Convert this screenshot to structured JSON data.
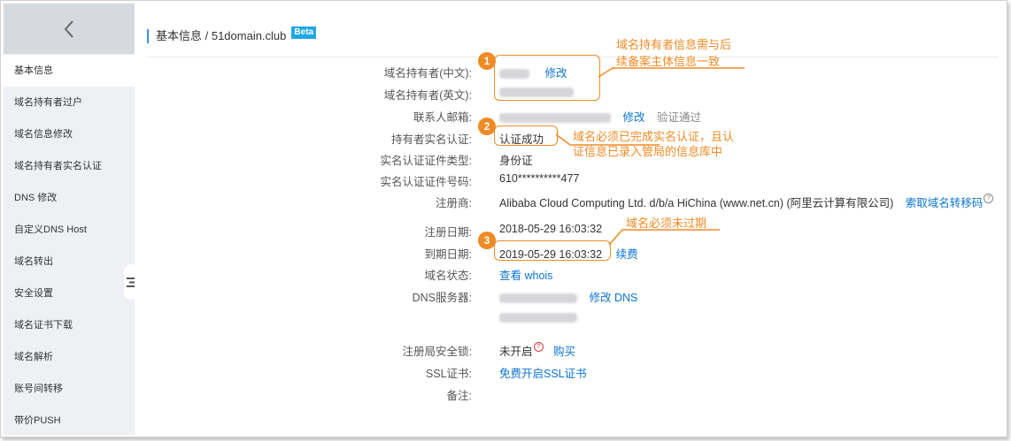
{
  "sidebar": {
    "back_icon": "chevron-left-icon",
    "items": [
      {
        "label": "基本信息"
      },
      {
        "label": "域名持有者过户"
      },
      {
        "label": "域名信息修改"
      },
      {
        "label": "域名持有者实名认证"
      },
      {
        "label": "DNS 修改"
      },
      {
        "label": "自定义DNS Host"
      },
      {
        "label": "域名转出"
      },
      {
        "label": "安全设置"
      },
      {
        "label": "域名证书下载"
      },
      {
        "label": "域名解析"
      },
      {
        "label": "账号间转移"
      },
      {
        "label": "带价PUSH"
      }
    ]
  },
  "header": {
    "breadcrumb": "基本信息 / 51domain.club",
    "beta": "Beta"
  },
  "fields": {
    "owner_cn_label": "域名持有者(中文):",
    "owner_cn_edit": "修改",
    "owner_en_label": "域名持有者(英文):",
    "email_label": "联系人邮箱:",
    "email_edit": "修改",
    "email_status": "验证通过",
    "realname_label": "持有者实名认证:",
    "realname_value": "认证成功",
    "cert_type_label": "实名认证证件类型:",
    "cert_type_value": "身份证",
    "cert_no_label": "实名认证证件号码:",
    "cert_no_value": "610**********477",
    "registrar_label": "注册商:",
    "registrar_value": "Alibaba Cloud Computing Ltd. d/b/a HiChina (www.net.cn) (阿里云计算有限公司)",
    "registrar_link": "索取域名转移码",
    "reg_date_label": "注册日期:",
    "reg_date_value": "2018-05-29 16:03:32",
    "exp_date_label": "到期日期:",
    "exp_date_value": "2019-05-29 16:03:32",
    "renew_link": "续费",
    "status_label": "域名状态:",
    "status_link": "查看 whois",
    "dns_label": "DNS服务器:",
    "dns_edit": "修改 DNS",
    "lock_label": "注册局安全锁:",
    "lock_value": "未开启",
    "lock_buy": "购买",
    "ssl_label": "SSL证书:",
    "ssl_link": "免费开启SSL证书",
    "remark_label": "备注:"
  },
  "annotations": {
    "n1": "1",
    "t1_line1": "域名持有者信息需与后",
    "t1_line2": "续备案主体信息一致",
    "n2": "2",
    "t2_line1": "域名必须已完成实名认证，且认",
    "t2_line2": "证信息已录入管局的信息库中",
    "n3": "3",
    "t3": "域名必须未过期"
  },
  "colors": {
    "accent": "#0d75d4",
    "annotation": "#ef8a24",
    "sidebar_bg": "#eef0f3",
    "beta_bg": "#22a7e6"
  }
}
